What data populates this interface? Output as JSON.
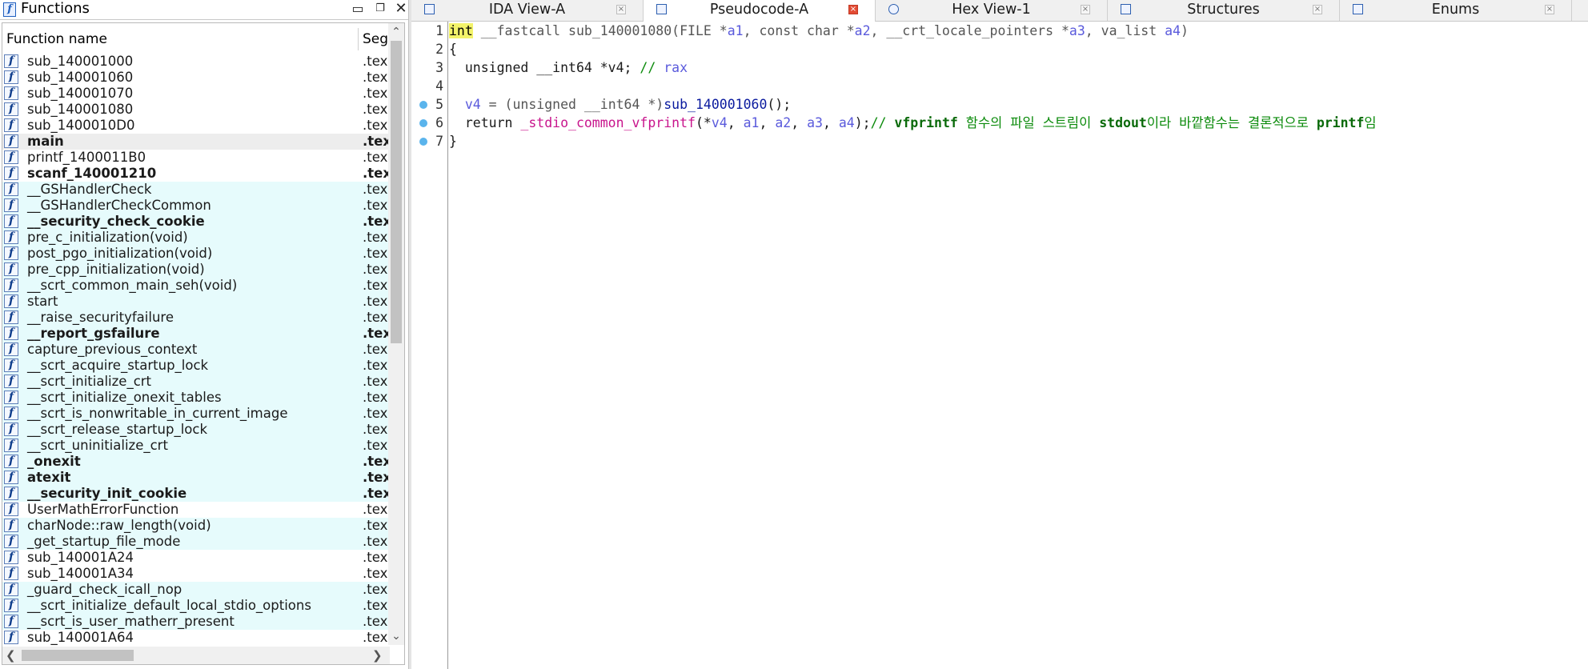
{
  "functions_panel": {
    "title": "Functions",
    "column_name": "Function name",
    "column_segment": "Seg",
    "rows": [
      {
        "name": "sub_140001000",
        "seg": ".tex",
        "hl": false,
        "bold": false,
        "sel": false
      },
      {
        "name": "sub_140001060",
        "seg": ".tex",
        "hl": false,
        "bold": false,
        "sel": false
      },
      {
        "name": "sub_140001070",
        "seg": ".tex",
        "hl": false,
        "bold": false,
        "sel": false
      },
      {
        "name": "sub_140001080",
        "seg": ".tex",
        "hl": false,
        "bold": false,
        "sel": false
      },
      {
        "name": "sub_1400010D0",
        "seg": ".tex",
        "hl": false,
        "bold": false,
        "sel": false
      },
      {
        "name": "main",
        "seg": ".tex",
        "hl": false,
        "bold": true,
        "sel": true
      },
      {
        "name": "printf_1400011B0",
        "seg": ".tex",
        "hl": false,
        "bold": false,
        "sel": false
      },
      {
        "name": "scanf_140001210",
        "seg": ".tex",
        "hl": false,
        "bold": true,
        "sel": false
      },
      {
        "name": "__GSHandlerCheck",
        "seg": ".tex",
        "hl": true,
        "bold": false,
        "sel": false
      },
      {
        "name": "__GSHandlerCheckCommon",
        "seg": ".tex",
        "hl": true,
        "bold": false,
        "sel": false
      },
      {
        "name": "__security_check_cookie",
        "seg": ".tex",
        "hl": true,
        "bold": true,
        "sel": false
      },
      {
        "name": "pre_c_initialization(void)",
        "seg": ".tex",
        "hl": true,
        "bold": false,
        "sel": false
      },
      {
        "name": "post_pgo_initialization(void)",
        "seg": ".tex",
        "hl": true,
        "bold": false,
        "sel": false
      },
      {
        "name": "pre_cpp_initialization(void)",
        "seg": ".tex",
        "hl": true,
        "bold": false,
        "sel": false
      },
      {
        "name": "__scrt_common_main_seh(void)",
        "seg": ".tex",
        "hl": true,
        "bold": false,
        "sel": false
      },
      {
        "name": "start",
        "seg": ".tex",
        "hl": true,
        "bold": false,
        "sel": false
      },
      {
        "name": "__raise_securityfailure",
        "seg": ".tex",
        "hl": true,
        "bold": false,
        "sel": false
      },
      {
        "name": "__report_gsfailure",
        "seg": ".tex",
        "hl": true,
        "bold": true,
        "sel": false
      },
      {
        "name": "capture_previous_context",
        "seg": ".tex",
        "hl": true,
        "bold": false,
        "sel": false
      },
      {
        "name": "__scrt_acquire_startup_lock",
        "seg": ".tex",
        "hl": true,
        "bold": false,
        "sel": false
      },
      {
        "name": "__scrt_initialize_crt",
        "seg": ".tex",
        "hl": true,
        "bold": false,
        "sel": false
      },
      {
        "name": "__scrt_initialize_onexit_tables",
        "seg": ".tex",
        "hl": true,
        "bold": false,
        "sel": false
      },
      {
        "name": "__scrt_is_nonwritable_in_current_image",
        "seg": ".tex",
        "hl": true,
        "bold": false,
        "sel": false
      },
      {
        "name": "__scrt_release_startup_lock",
        "seg": ".tex",
        "hl": true,
        "bold": false,
        "sel": false
      },
      {
        "name": "__scrt_uninitialize_crt",
        "seg": ".tex",
        "hl": true,
        "bold": false,
        "sel": false
      },
      {
        "name": "_onexit",
        "seg": ".tex",
        "hl": true,
        "bold": true,
        "sel": false
      },
      {
        "name": "atexit",
        "seg": ".tex",
        "hl": true,
        "bold": true,
        "sel": false
      },
      {
        "name": "__security_init_cookie",
        "seg": ".tex",
        "hl": true,
        "bold": true,
        "sel": false
      },
      {
        "name": "UserMathErrorFunction",
        "seg": ".tex",
        "hl": false,
        "bold": false,
        "sel": false
      },
      {
        "name": "charNode::raw_length(void)",
        "seg": ".tex",
        "hl": true,
        "bold": false,
        "sel": false
      },
      {
        "name": "_get_startup_file_mode",
        "seg": ".tex",
        "hl": true,
        "bold": false,
        "sel": false
      },
      {
        "name": "sub_140001A24",
        "seg": ".tex",
        "hl": false,
        "bold": false,
        "sel": false
      },
      {
        "name": "sub_140001A34",
        "seg": ".tex",
        "hl": false,
        "bold": false,
        "sel": false
      },
      {
        "name": "_guard_check_icall_nop",
        "seg": ".tex",
        "hl": true,
        "bold": false,
        "sel": false
      },
      {
        "name": "__scrt_initialize_default_local_stdio_options",
        "seg": ".tex",
        "hl": true,
        "bold": false,
        "sel": false
      },
      {
        "name": "__scrt_is_user_matherr_present",
        "seg": ".tex",
        "hl": true,
        "bold": false,
        "sel": false
      },
      {
        "name": "sub_140001A64",
        "seg": ".tex",
        "hl": false,
        "bold": false,
        "sel": false
      }
    ]
  },
  "tabs": [
    {
      "label": "IDA View-A",
      "active": false
    },
    {
      "label": "Pseudocode-A",
      "active": true
    },
    {
      "label": "Hex View-1",
      "active": false
    },
    {
      "label": "Structures",
      "active": false
    },
    {
      "label": "Enums",
      "active": false
    }
  ],
  "code": {
    "line_numbers": [
      "1",
      "2",
      "3",
      "4",
      "5",
      "6",
      "7"
    ],
    "line1": {
      "kw_int": "int",
      "rest_a": " __fastcall sub_140001080(FILE *",
      "a1": "a1",
      "rest_b": ", const char *",
      "a2": "a2",
      "rest_c": ", __crt_locale_pointers *",
      "a3": "a3",
      "rest_d": ", va_list ",
      "a4": "a4",
      "rest_e": ")"
    },
    "line2": "{",
    "line3": {
      "decl": "  unsigned __int64 *v4; ",
      "comment": "// ",
      "reg": "rax"
    },
    "line5": {
      "indent": "  ",
      "v4": "v4",
      "assign": " = (unsigned __int64 *)",
      "call": "sub_140001060",
      "end": "();"
    },
    "line6": {
      "ret": "  return ",
      "fn": "_stdio_common_vfprintf",
      "open": "(*",
      "v4": "v4",
      "c1": ", ",
      "a1": "a1",
      "c2": ", ",
      "a2": "a2",
      "c3": ", ",
      "a3": "a3",
      "c4": ", ",
      "a4": "a4",
      "close": ");",
      "cmt1": "// ",
      "cmt_vf": "vfprintf",
      "cmt2": " 함수의 파일 스트림이 ",
      "cmt_stdout": "stdout",
      "cmt3": "이라 바깥함수는 결론적으로 ",
      "cmt_printf": "printf",
      "cmt4": "임"
    },
    "line7": "}",
    "breakpoint_lines": [
      5,
      6,
      7
    ]
  }
}
